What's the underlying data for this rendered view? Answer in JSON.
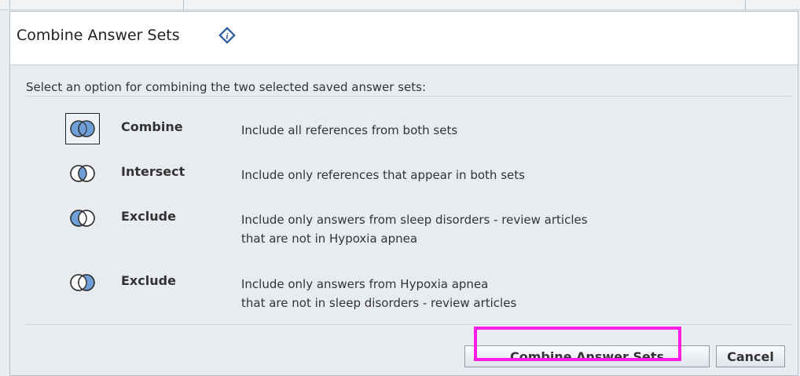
{
  "dialog": {
    "title": "Combine Answer Sets",
    "title_icon": "info-icon",
    "prompt": "Select an option for combining the two selected saved answer sets:",
    "options": [
      {
        "label": "Combine",
        "description": "Include all references from both sets",
        "icon": "venn-union-icon",
        "selected": true
      },
      {
        "label": "Intersect",
        "description": "Include only references that appear in both sets",
        "icon": "venn-intersect-icon",
        "selected": false
      },
      {
        "label": "Exclude",
        "description_line1": "Include only answers from sleep disorders - review articles",
        "description_line2": "that are not in Hypoxia apnea",
        "icon": "venn-left-only-icon",
        "selected": false
      },
      {
        "label": "Exclude",
        "description_line1": "Include only answers from Hypoxia apnea",
        "description_line2": "that are not in sleep disorders - review articles",
        "icon": "venn-right-only-icon",
        "selected": false
      }
    ],
    "buttons": {
      "combine_label": "Combine Answer Sets",
      "cancel_label": "Cancel"
    },
    "colors": {
      "venn_fill": "#6f9fd8",
      "highlight": "#ff1de8"
    }
  }
}
